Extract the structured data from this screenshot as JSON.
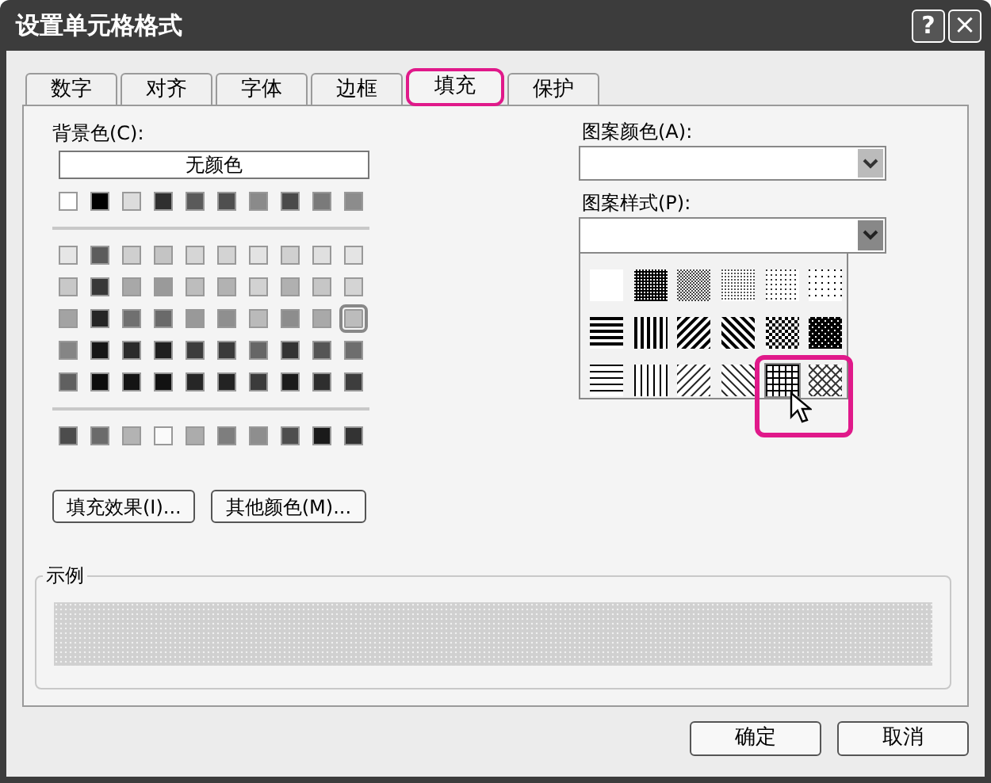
{
  "window": {
    "title": "设置单元格格式",
    "help_button": "?",
    "close_button": "×"
  },
  "tabs": [
    {
      "label": "数字",
      "selected": false
    },
    {
      "label": "对齐",
      "selected": false
    },
    {
      "label": "字体",
      "selected": false
    },
    {
      "label": "边框",
      "selected": false
    },
    {
      "label": "填充",
      "selected": true
    },
    {
      "label": "保护",
      "selected": false
    }
  ],
  "background_color": {
    "label": "背景色(C):",
    "no_color_button": "无颜色",
    "swatch_rows": [
      [
        {
          "color": "#ffffff",
          "selected": false
        },
        {
          "color": "#000000",
          "selected": false
        },
        {
          "color": "#dcdcdc",
          "selected": false
        },
        {
          "color": "#2f2f2f",
          "selected": false
        },
        {
          "color": "#5a5a5a",
          "selected": false
        },
        {
          "color": "#4f4f4f",
          "selected": false
        },
        {
          "color": "#8a8a8a",
          "selected": false
        },
        {
          "color": "#4a4a4a",
          "selected": false
        },
        {
          "color": "#7a7a7a",
          "selected": false
        },
        {
          "color": "#8c8c8c",
          "selected": false
        }
      ],
      [
        {
          "color": "#e6e6e6",
          "selected": false
        },
        {
          "color": "#5c5c5c",
          "selected": false
        },
        {
          "color": "#cfcfcf",
          "selected": false
        },
        {
          "color": "#c4c4c4",
          "selected": false
        },
        {
          "color": "#d6d6d6",
          "selected": false
        },
        {
          "color": "#d3d3d3",
          "selected": false
        },
        {
          "color": "#e3e3e3",
          "selected": false
        },
        {
          "color": "#d0d0d0",
          "selected": false
        },
        {
          "color": "#e0e0e0",
          "selected": false
        },
        {
          "color": "#e4e4e4",
          "selected": false
        }
      ],
      [
        {
          "color": "#c8c8c8",
          "selected": false
        },
        {
          "color": "#383838",
          "selected": false
        },
        {
          "color": "#a8a8a8",
          "selected": false
        },
        {
          "color": "#9a9a9a",
          "selected": false
        },
        {
          "color": "#bdbdbd",
          "selected": false
        },
        {
          "color": "#b2b2b2",
          "selected": false
        },
        {
          "color": "#d2d2d2",
          "selected": false
        },
        {
          "color": "#b0b0b0",
          "selected": false
        },
        {
          "color": "#c6c6c6",
          "selected": false
        },
        {
          "color": "#d4d4d4",
          "selected": false
        }
      ],
      [
        {
          "color": "#a3a3a3",
          "selected": false
        },
        {
          "color": "#262626",
          "selected": false
        },
        {
          "color": "#707070",
          "selected": false
        },
        {
          "color": "#6a6a6a",
          "selected": false
        },
        {
          "color": "#999999",
          "selected": false
        },
        {
          "color": "#8f8f8f",
          "selected": false
        },
        {
          "color": "#bababa",
          "selected": false
        },
        {
          "color": "#8d8d8d",
          "selected": false
        },
        {
          "color": "#a9a9a9",
          "selected": false
        },
        {
          "color": "#bcbcbc",
          "selected": true
        }
      ],
      [
        {
          "color": "#858585",
          "selected": false
        },
        {
          "color": "#161616",
          "selected": false
        },
        {
          "color": "#2b2b2b",
          "selected": false
        },
        {
          "color": "#1f1f1f",
          "selected": false
        },
        {
          "color": "#3c3c3c",
          "selected": false
        },
        {
          "color": "#3a3a3a",
          "selected": false
        },
        {
          "color": "#666666",
          "selected": false
        },
        {
          "color": "#333333",
          "selected": false
        },
        {
          "color": "#555555",
          "selected": false
        },
        {
          "color": "#6e6e6e",
          "selected": false
        }
      ],
      [
        {
          "color": "#606060",
          "selected": false
        },
        {
          "color": "#0d0d0d",
          "selected": false
        },
        {
          "color": "#141414",
          "selected": false
        },
        {
          "color": "#121212",
          "selected": false
        },
        {
          "color": "#262626",
          "selected": false
        },
        {
          "color": "#232323",
          "selected": false
        },
        {
          "color": "#3b3b3b",
          "selected": false
        },
        {
          "color": "#1c1c1c",
          "selected": false
        },
        {
          "color": "#2e2e2e",
          "selected": false
        },
        {
          "color": "#3d3d3d",
          "selected": false
        }
      ],
      [
        {
          "color": "#4c4c4c",
          "selected": false
        },
        {
          "color": "#6b6b6b",
          "selected": false
        },
        {
          "color": "#b3b3b3",
          "selected": false
        },
        {
          "color": "#fafafa",
          "selected": false
        },
        {
          "color": "#acacac",
          "selected": false
        },
        {
          "color": "#7e7e7e",
          "selected": false
        },
        {
          "color": "#8e8e8e",
          "selected": false
        },
        {
          "color": "#4e4e4e",
          "selected": false
        },
        {
          "color": "#1a1a1a",
          "selected": false
        },
        {
          "color": "#333333",
          "selected": false
        }
      ]
    ]
  },
  "buttons": [
    {
      "label": "填充效果(I)..."
    },
    {
      "label": "其他颜色(M)..."
    }
  ],
  "pattern_color": {
    "label": "图案颜色(A):"
  },
  "pattern_style": {
    "label": "图案样式(P):",
    "patterns": [
      {
        "kind": "solid",
        "selected": false
      },
      {
        "kind": "dark75",
        "selected": false
      },
      {
        "kind": "gray50",
        "selected": false
      },
      {
        "kind": "gray25",
        "selected": false
      },
      {
        "kind": "gray12",
        "selected": false
      },
      {
        "kind": "gray6",
        "selected": false
      },
      {
        "kind": "hstripe",
        "selected": false
      },
      {
        "kind": "vstripe",
        "selected": false
      },
      {
        "kind": "rdiag",
        "selected": false
      },
      {
        "kind": "diag",
        "selected": false
      },
      {
        "kind": "diagcross",
        "selected": false
      },
      {
        "kind": "thickcross",
        "selected": false
      },
      {
        "kind": "thinh",
        "selected": false
      },
      {
        "kind": "thinv",
        "selected": false
      },
      {
        "kind": "thinrdiag",
        "selected": false
      },
      {
        "kind": "thindiag",
        "selected": false
      },
      {
        "kind": "thingrid",
        "selected": true
      },
      {
        "kind": "thincross",
        "selected": false
      }
    ]
  },
  "sample": {
    "label": "示例"
  },
  "footer_buttons": [
    "确定",
    "取消"
  ]
}
